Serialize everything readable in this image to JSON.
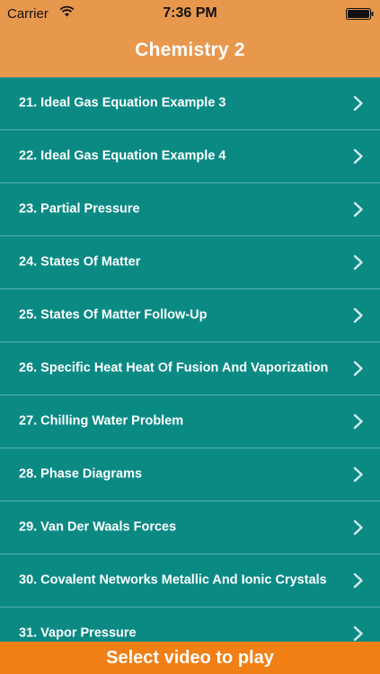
{
  "status_bar": {
    "carrier": "Carrier",
    "time": "7:36 PM",
    "wifi_icon": "wifi-icon",
    "battery_icon": "battery-icon"
  },
  "nav": {
    "title": "Chemistry 2"
  },
  "list": {
    "items": [
      {
        "label": "21. Ideal Gas Equation Example 3"
      },
      {
        "label": "22. Ideal Gas Equation Example 4"
      },
      {
        "label": "23. Partial Pressure"
      },
      {
        "label": "24. States Of Matter"
      },
      {
        "label": "25. States Of Matter Follow-Up"
      },
      {
        "label": "26. Specific Heat Heat Of Fusion And Vaporization"
      },
      {
        "label": "27. Chilling Water Problem"
      },
      {
        "label": "28. Phase Diagrams"
      },
      {
        "label": "29. Van Der Waals Forces"
      },
      {
        "label": "30. Covalent Networks Metallic And Ionic Crystals"
      },
      {
        "label": "31. Vapor Pressure"
      }
    ],
    "row_icon": "chevron-right-icon"
  },
  "footer": {
    "label": "Select video to play"
  },
  "colors": {
    "header_bg": "#e8984d",
    "list_bg": "#0b8a84",
    "separator": "#55b3ad",
    "footer_bg": "#f07f16",
    "text": "#ffffff"
  }
}
